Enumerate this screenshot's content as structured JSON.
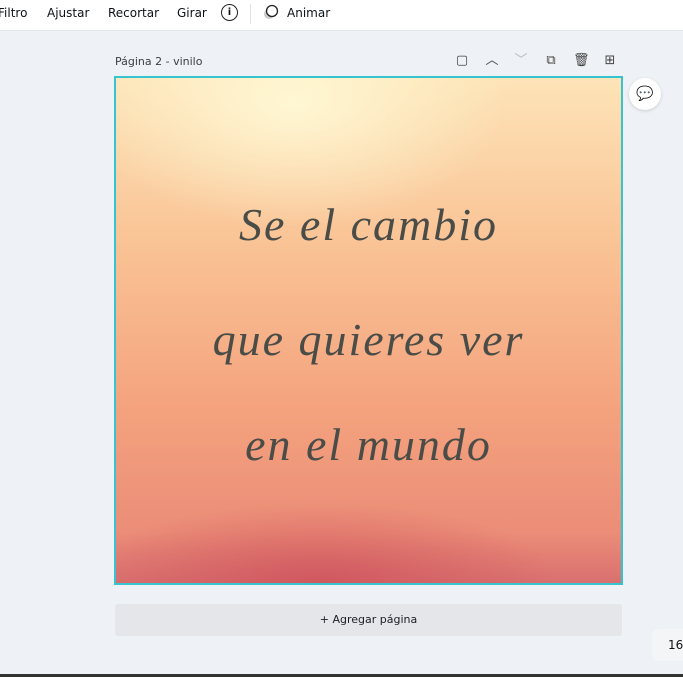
{
  "toolbar": {
    "filter": "Filtro",
    "adjust": "Ajustar",
    "crop": "Recortar",
    "rotate": "Girar",
    "info_icon": "info-icon",
    "animate": "Animar"
  },
  "page": {
    "label": "Página 2 - vinilo",
    "icons": [
      "note-icon",
      "chevron-up-icon",
      "chevron-down-icon",
      "duplicate-icon",
      "trash-icon",
      "add-page-icon"
    ]
  },
  "design": {
    "lines": [
      "Se el cambio",
      "que quieres ver",
      "en el mundo"
    ],
    "border_color": "#36c5d0"
  },
  "add_page": "+ Agregar página",
  "zoom": "16"
}
